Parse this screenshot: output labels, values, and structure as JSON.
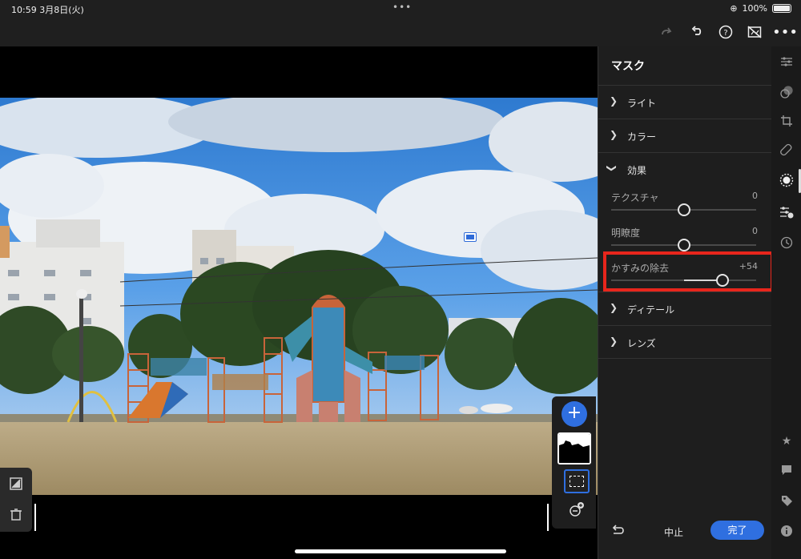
{
  "status_bar": {
    "time": "10:59",
    "date": "3月8日(火)",
    "battery": "100%",
    "dots": "•••"
  },
  "toolbar": {
    "redo_icon": "redo-icon",
    "undo_icon": "undo-icon",
    "help_icon": "help-icon",
    "compare_icon": "compare-icon",
    "more_icon": "more-icon"
  },
  "panel": {
    "title": "マスク",
    "sections": [
      {
        "label": "ライト",
        "expanded": false
      },
      {
        "label": "カラー",
        "expanded": false
      },
      {
        "label": "効果",
        "expanded": true
      },
      {
        "label": "ディテール",
        "expanded": false
      },
      {
        "label": "レンズ",
        "expanded": false
      }
    ],
    "sliders": [
      {
        "name": "テクスチャ",
        "value": "0",
        "position": 0.5
      },
      {
        "name": "明瞭度",
        "value": "0",
        "position": 0.5
      },
      {
        "name": "かすみの除去",
        "value": "+54",
        "position": 0.77
      }
    ],
    "footer": {
      "cancel": "中止",
      "done": "完了"
    }
  },
  "mask_panel": {
    "add": "+"
  },
  "colors": {
    "accent": "#2f6fe0",
    "highlight": "#e8261c",
    "panel_bg": "#1e1e1e"
  }
}
